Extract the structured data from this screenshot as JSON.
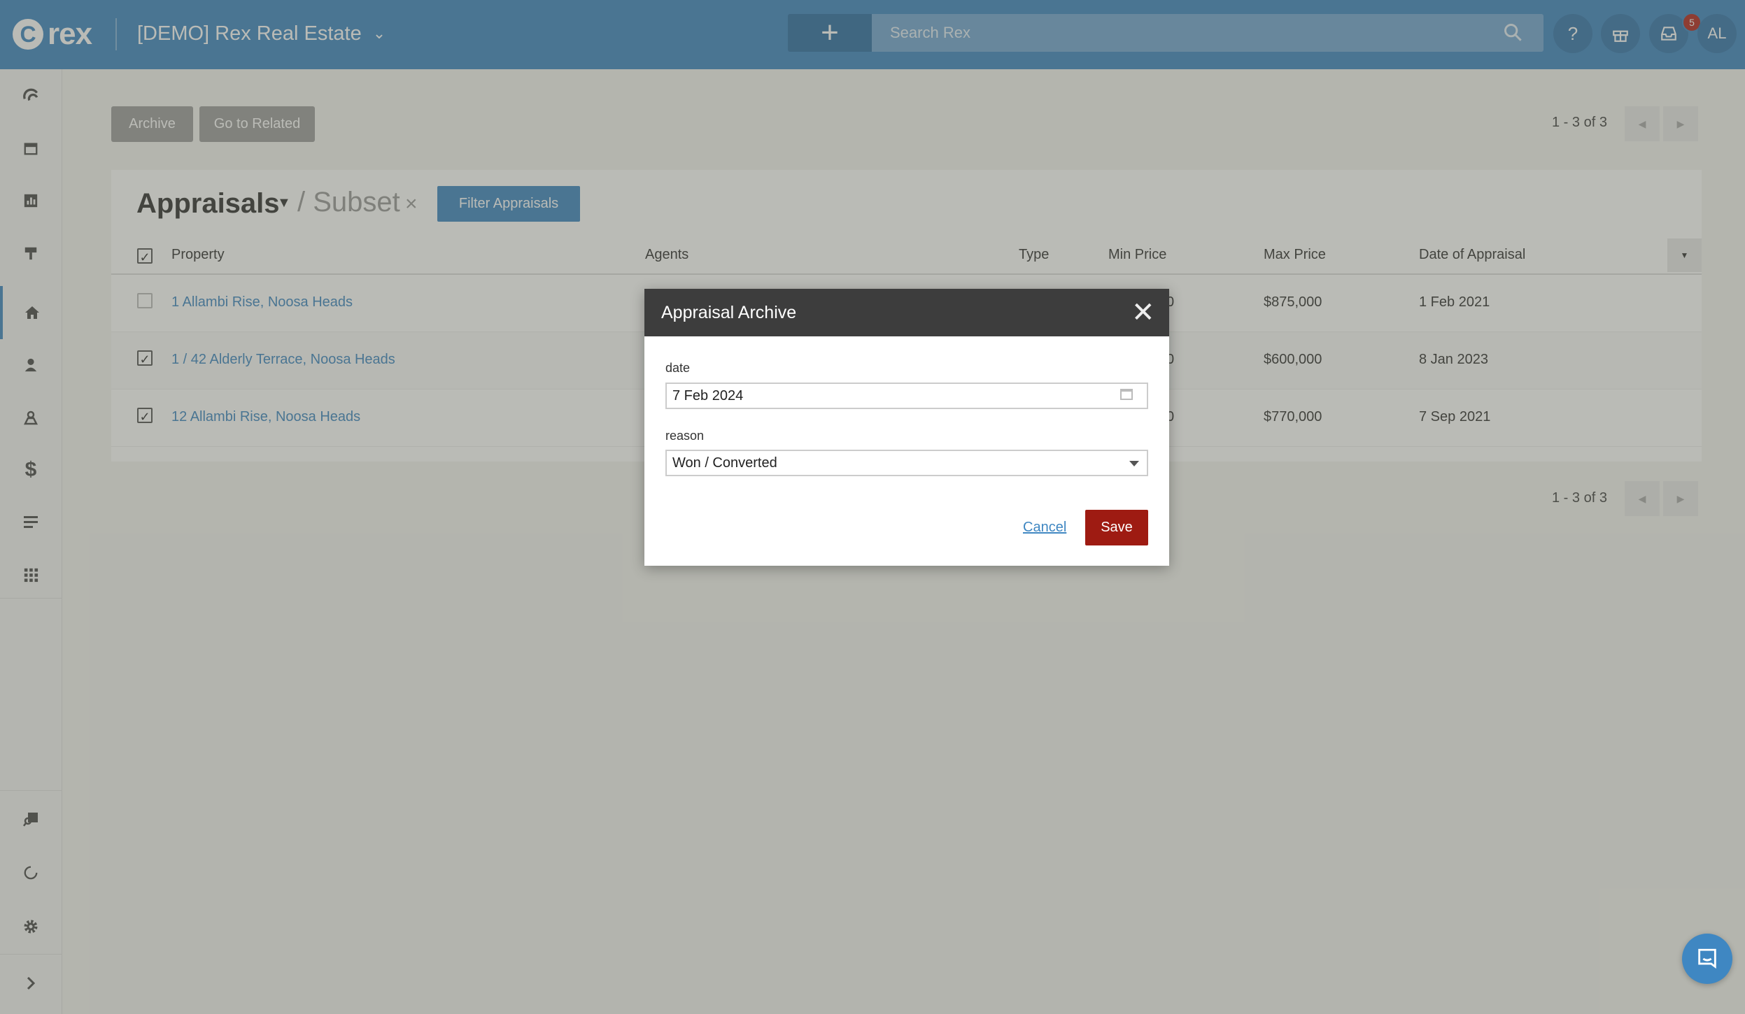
{
  "app": {
    "logo_text": "rex",
    "account_name": "[DEMO] Rex Real Estate"
  },
  "topbar": {
    "add_label": "+",
    "search_placeholder": "Search Rex",
    "help_label": "?",
    "notification_count": "5",
    "user_initials": "AL"
  },
  "sidebar": {
    "icons": [
      "dashboard-icon",
      "calendar-icon",
      "reports-icon",
      "listings-icon",
      "properties-icon",
      "contacts-icon",
      "appraisals-icon",
      "finance-icon",
      "lists-icon",
      "apps-icon",
      "search-map-icon",
      "refresh-icon",
      "settings-icon",
      "expand-icon"
    ]
  },
  "toolbar": {
    "archive_label": "Archive",
    "related_label": "Go to Related"
  },
  "pager": {
    "top_text": "1 - 3 of 3",
    "bottom_text": "1 - 3 of 3"
  },
  "panel": {
    "title": "Appraisals",
    "subset_label": "/ Subset",
    "subset_clear": "×",
    "filter_label": "Filter Appraisals"
  },
  "table": {
    "headers": {
      "property": "Property",
      "agents": "Agents",
      "type": "Type",
      "min_price": "Min Price",
      "max_price": "Max Price",
      "date": "Date of Appraisal"
    },
    "rows": [
      {
        "property": "1 Allambi Rise, Noosa Heads",
        "min_frag": "0",
        "max_price": "$875,000",
        "date": "1 Feb 2021",
        "checked": false
      },
      {
        "property": "1 / 42 Alderly Terrace, Noosa Heads",
        "min_frag": "0",
        "max_price": "$600,000",
        "date": "8 Jan 2023",
        "checked": true
      },
      {
        "property": "12 Allambi Rise, Noosa Heads",
        "min_frag": "0",
        "max_price": "$770,000",
        "date": "7 Sep 2021",
        "checked": true
      }
    ]
  },
  "modal": {
    "title": "Appraisal Archive",
    "close_label": "✕",
    "date_label": "date",
    "date_value": "7 Feb 2024",
    "reason_label": "reason",
    "reason_value": "Won / Converted",
    "cancel_label": "Cancel",
    "save_label": "Save"
  },
  "colors": {
    "brand": "#3f87c2",
    "save": "#9e1b12",
    "modal_header": "#3d3d3d"
  }
}
